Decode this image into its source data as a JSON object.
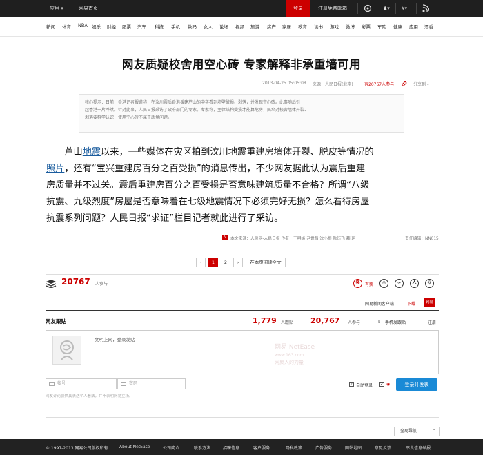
{
  "topbar": {
    "apps": "应用 ▾",
    "home": "网易首页",
    "login": "登录",
    "register": "注册免费邮箱",
    "icons": [
      "weibo-icon",
      "user-icon",
      "cart-icon",
      "rss-icon"
    ],
    "cart_label": "¥▾",
    "user_label": "♟▾"
  },
  "nav": {
    "items": [
      "新闻",
      "体育",
      "NBA",
      "娱乐",
      "财经",
      "股票",
      "汽车",
      "科技",
      "手机",
      "数码",
      "女人",
      "论坛",
      "视频",
      "旅游",
      "房产",
      "家居",
      "教育",
      "读书",
      "游戏",
      "微博",
      "彩票",
      "车险",
      "健康",
      "应用",
      "酒香"
    ]
  },
  "article": {
    "title": "网友质疑校舍用空心砖 专家解释非承重墙可用",
    "datetime": "2013-04-25 05:05:08",
    "source_label": "来源：人民日报(北京)",
    "participants": "有20767人参与",
    "share": "分享到 ▾",
    "summary_lines": [
      "核心提示：日前，香港记者报道称，在汶川震后香港援建芦山的中学看到墙壁破损、剥落，并发现空心砖。此事随后引",
      "起香港一片哗然。针对此事，人民日报采访了政府部门的专家。专家称，主体结构受损才能算危房，民众对校舍墙体开裂、",
      "剥落要科学认识，使用空心砖不属于质量问题。"
    ],
    "body": {
      "l1_a": "芦山",
      "l1_link": "地震",
      "l1_b": "以来，一些媒体在灾区拍到汶川地震重建房墙体开裂、脱皮等情况的",
      "l2_link": "照片",
      "l2_b": "，还有“宝兴重建房百分之百受损”的消息传出，不少网友据此认为震后重建",
      "l3": "房质量并不过关。震后重建房百分之百受损是否意味建筑质量不合格？所谓“八级",
      "l4": "抗震、九级烈度”房屋是否意味着在七级地震情况下必须完好无损？怎么看待房屋",
      "l5": "抗震系列问题？人民日报“求证”栏目记者就此进行了采访。"
    },
    "source_line": "本文来源：人民网-人民日报  作者：王明峰 尹世昌 沈小根 陈衍飞 薛 珂",
    "editor": "责任编辑：NN015"
  },
  "pager": {
    "prev": "‹",
    "pages": [
      "1",
      "2"
    ],
    "next": "›",
    "read_all": "在本页阅读全文"
  },
  "stats": {
    "participants_num": "20767",
    "participants_label": "人参与",
    "share_label": "有奖",
    "share_icons": [
      "netease-weibo-icon",
      "sina-weibo-icon",
      "qzone-icon",
      "renren-icon",
      "douban-icon"
    ]
  },
  "client": {
    "text": "网易新闻客户端",
    "download": "下载",
    "logo": "网易"
  },
  "comments": {
    "title": "网友跟贴",
    "follow_num": "1,779",
    "follow_label": "人跟贴",
    "join_num": "20,767",
    "join_label": "人参与",
    "mobile": "手机发跟贴",
    "register": "注册",
    "placeholder": "文明上网，登录发贴",
    "watermark_1": "网易 NetEase",
    "watermark_2": "www.163.com",
    "watermark_3": "网聚人的力量",
    "username_placeholder": "帐号",
    "password_placeholder": "密码",
    "hint": "网友评论仅供其表达个人看法，并不表明网易立场。",
    "auto_login": "自动登录",
    "submit": "登录并发表",
    "full_nav": "全局导航"
  },
  "footer": {
    "copyright": "© 1997-2013 网易公司版权所有",
    "links": [
      "About NetEase",
      "公司简介",
      "联系方法",
      "招聘信息",
      "客户服务",
      "隐私政策",
      "广告服务",
      "网站地图",
      "意见反馈",
      "不良信息举报"
    ]
  },
  "colors": {
    "accent": "#cc0000",
    "link": "#1a5c9e",
    "submit": "#1a8ad6",
    "topbar": "#1f1f1f"
  }
}
